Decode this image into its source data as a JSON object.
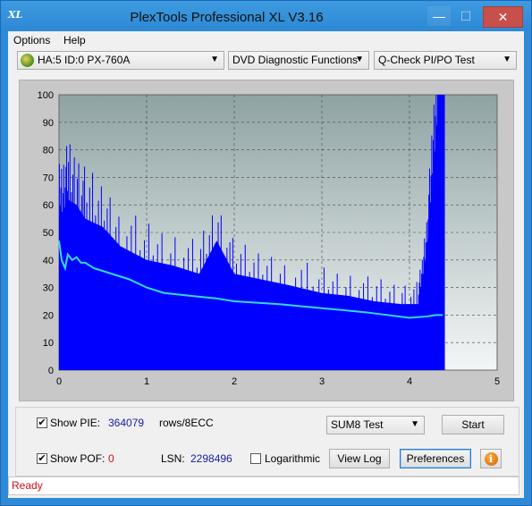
{
  "window": {
    "title": "PlexTools Professional XL V3.16",
    "icon_text": "XL"
  },
  "window_buttons": {
    "minimize": "—",
    "maximize": "☐",
    "close": "✕"
  },
  "menu": {
    "items": [
      "Options",
      "Help"
    ]
  },
  "toolbar": {
    "drive": "HA:5 ID:0  PX-760A",
    "function": "DVD Diagnostic Functions",
    "test": "Q-Check PI/PO Test"
  },
  "chart_data": {
    "type": "area",
    "x_ticks": [
      "0",
      "1",
      "2",
      "3",
      "4",
      "5"
    ],
    "y_ticks": [
      "0",
      "10",
      "20",
      "30",
      "40",
      "50",
      "60",
      "70",
      "80",
      "90",
      "100"
    ],
    "xlim": [
      0,
      5
    ],
    "ylim": [
      0,
      100
    ],
    "grid": true,
    "series": [
      {
        "kind": "pie-bars",
        "color": "#0000ff",
        "x": [
          0,
          0.05,
          0.1,
          0.2,
          0.3,
          0.5,
          0.7,
          1.0,
          1.3,
          1.6,
          1.8,
          2.0,
          2.3,
          2.6,
          3.0,
          3.3,
          3.6,
          3.9,
          4.1,
          4.15,
          4.2,
          4.25,
          4.3,
          4.35,
          4.38,
          4.4
        ],
        "values": [
          56,
          58,
          62,
          60,
          55,
          52,
          45,
          40,
          38,
          35,
          47,
          35,
          33,
          31,
          28,
          27,
          25,
          24,
          24,
          32,
          45,
          62,
          85,
          100,
          100,
          100
        ]
      },
      {
        "kind": "pif-line",
        "color": "#33d9e8",
        "x": [
          0,
          0.03,
          0.07,
          0.1,
          0.15,
          0.2,
          0.25,
          0.3,
          0.4,
          0.5,
          0.6,
          0.8,
          1.0,
          1.2,
          1.5,
          1.8,
          2.0,
          2.5,
          3.0,
          3.5,
          4.0,
          4.2,
          4.3,
          4.38
        ],
        "values": [
          47,
          40,
          37,
          42,
          40,
          41,
          39,
          39,
          37,
          36,
          35,
          33,
          30,
          28,
          27,
          26,
          25,
          24,
          22.5,
          21,
          19,
          19.5,
          20,
          20
        ]
      }
    ]
  },
  "controls": {
    "show_pie_label": "Show PIE:",
    "pie_value": "364079",
    "rows_label": "rows/8ECC",
    "show_pof_label": "Show POF:",
    "pof_value": "0",
    "lsn_label": "LSN:",
    "lsn_value": "2298496",
    "logarithmic_label": "Logarithmic",
    "sum_select": "SUM8 Test",
    "start_button": "Start",
    "view_log_button": "View Log",
    "preferences_button": "Preferences",
    "info_icon": "i",
    "show_pie_checked": "✔",
    "show_pof_checked": "✔"
  },
  "status": {
    "text": "Ready"
  }
}
